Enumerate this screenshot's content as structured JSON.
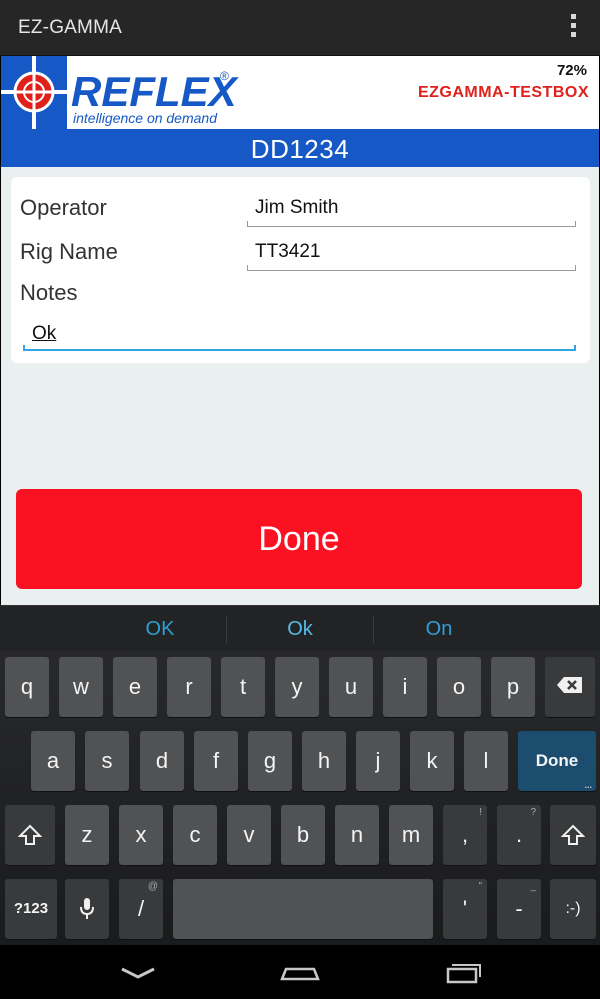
{
  "app": {
    "title": "EZ-GAMMA"
  },
  "header": {
    "battery": "72%",
    "device_name": "EZGAMMA-TESTBOX",
    "logo_text": "REFLEX",
    "logo_tagline": "intelligence on demand"
  },
  "hole": {
    "id": "DD1234"
  },
  "form": {
    "operator_label": "Operator",
    "operator_value": "Jim Smith",
    "rig_label": "Rig Name",
    "rig_value": "TT3421",
    "notes_label": "Notes",
    "notes_value": "Ok"
  },
  "done_button": "Done",
  "keyboard": {
    "suggestions": [
      "OK",
      "Ok",
      "On"
    ],
    "row1": [
      "q",
      "w",
      "e",
      "r",
      "t",
      "y",
      "u",
      "i",
      "o",
      "p"
    ],
    "row2": [
      "a",
      "s",
      "d",
      "f",
      "g",
      "h",
      "j",
      "k",
      "l"
    ],
    "row3": [
      "z",
      "x",
      "c",
      "v",
      "b",
      "n",
      "m",
      ",",
      "."
    ],
    "row3_hints": [
      "!",
      "?"
    ],
    "action_label": "Done",
    "symbols_label": "?123",
    "slash_label": "/",
    "slash_hint": "@",
    "apostrophe_label": "'",
    "apostrophe_hint": "\"",
    "dash_label": "-",
    "dash_hint": "_",
    "smiley_label": ":-)"
  },
  "colors": {
    "brand_blue": "#1558c6",
    "done_red": "#fc1123",
    "device_red": "#e0201b",
    "focus_blue": "#33a5e6"
  }
}
